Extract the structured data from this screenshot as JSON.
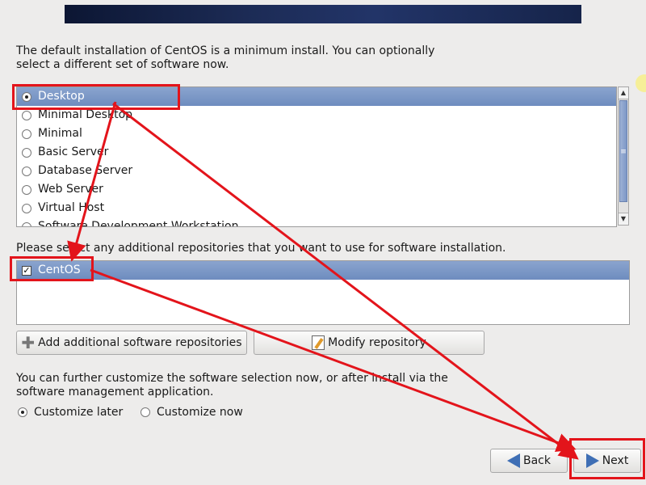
{
  "intro_text": "The default installation of CentOS is a minimum install. You can optionally select a different set of software now.",
  "software_groups": [
    {
      "label": "Desktop",
      "selected": true
    },
    {
      "label": "Minimal Desktop",
      "selected": false
    },
    {
      "label": "Minimal",
      "selected": false
    },
    {
      "label": "Basic Server",
      "selected": false
    },
    {
      "label": "Database Server",
      "selected": false
    },
    {
      "label": "Web Server",
      "selected": false
    },
    {
      "label": "Virtual Host",
      "selected": false
    },
    {
      "label": "Software Development Workstation",
      "selected": false
    }
  ],
  "repo_prompt": "Please select any additional repositories that you want to use for software installation.",
  "repositories": [
    {
      "label": "CentOS",
      "checked": true
    }
  ],
  "buttons": {
    "add_repo": "Add additional software repositories",
    "modify_repo": "Modify repository",
    "back": "Back",
    "next": "Next"
  },
  "customize_text": "You can further customize the software selection now, or after install via the software management application.",
  "customize_options": [
    {
      "label": "Customize later",
      "selected": true
    },
    {
      "label": "Customize now",
      "selected": false
    }
  ],
  "icons": {
    "add": "plus-icon",
    "modify": "edit-icon",
    "back": "arrow-left-icon",
    "next": "arrow-right-icon"
  },
  "colors": {
    "annotation": "#e3141b",
    "selection": "#7895c6",
    "background": "#edeceb"
  }
}
